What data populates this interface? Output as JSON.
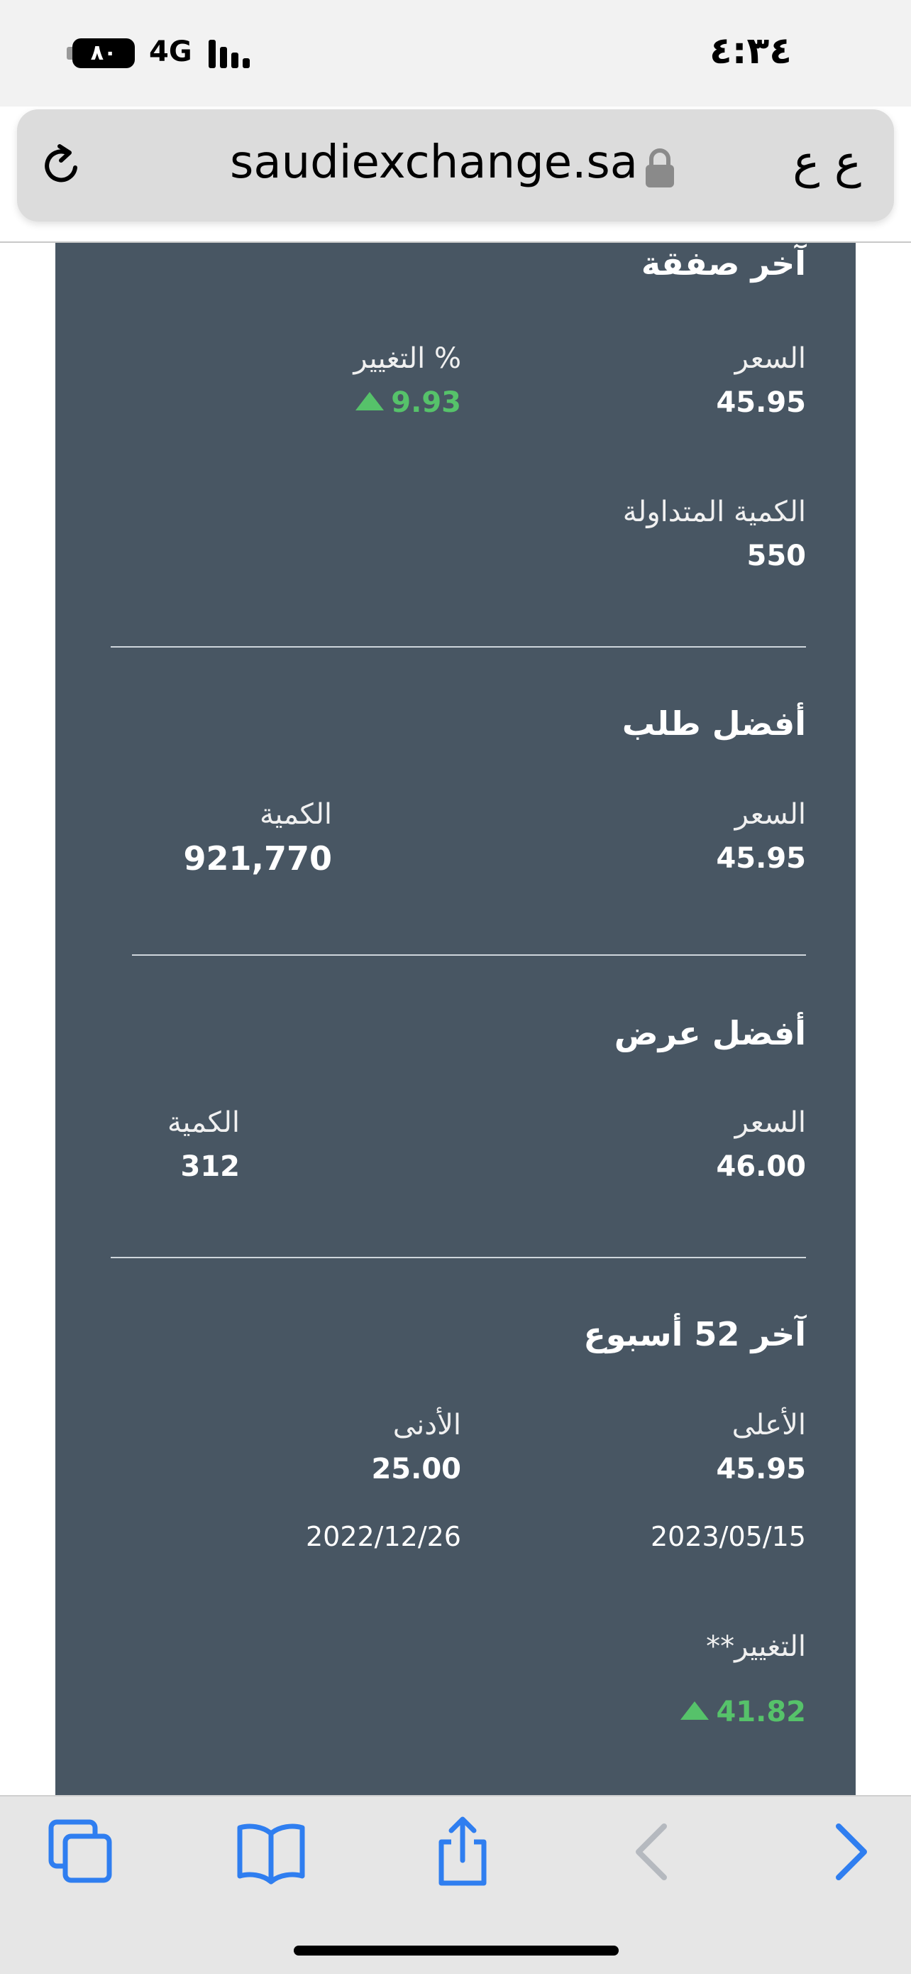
{
  "status_bar": {
    "battery": "٨٠",
    "network": "4G",
    "time": "٤:٣٤"
  },
  "address_bar": {
    "url": "saudiexchange.sa",
    "text_size_button": "ع ع"
  },
  "last_trade": {
    "heading": "آخر صفقة",
    "price_label": "السعر",
    "price_value": "45.95",
    "change_label": "% التغيير",
    "change_value": "9.93",
    "volume_label": "الكمية المتداولة",
    "volume_value": "550"
  },
  "best_bid": {
    "heading": "أفضل طلب",
    "price_label": "السعر",
    "price_value": "45.95",
    "qty_label": "الكمية",
    "qty_value": "921,770"
  },
  "best_offer": {
    "heading": "أفضل عرض",
    "price_label": "السعر",
    "price_value": "46.00",
    "qty_label": "الكمية",
    "qty_value": "312"
  },
  "week52": {
    "heading": "آخر 52 أسبوع",
    "high_label": "الأعلى",
    "high_value": "45.95",
    "high_date": "2023/05/15",
    "low_label": "الأدنى",
    "low_value": "25.00",
    "low_date": "2022/12/26",
    "change_label": "التغيير**",
    "change_value": "41.82"
  },
  "colors": {
    "panel": "#485663",
    "positive": "#56c26a",
    "toolbar_icon": "#2f7ef0",
    "toolbar_icon_disabled": "#b5b9bf"
  },
  "toolbar": {
    "icons": [
      "tabs-icon",
      "bookmarks-icon",
      "share-icon",
      "back-icon",
      "forward-icon"
    ]
  }
}
